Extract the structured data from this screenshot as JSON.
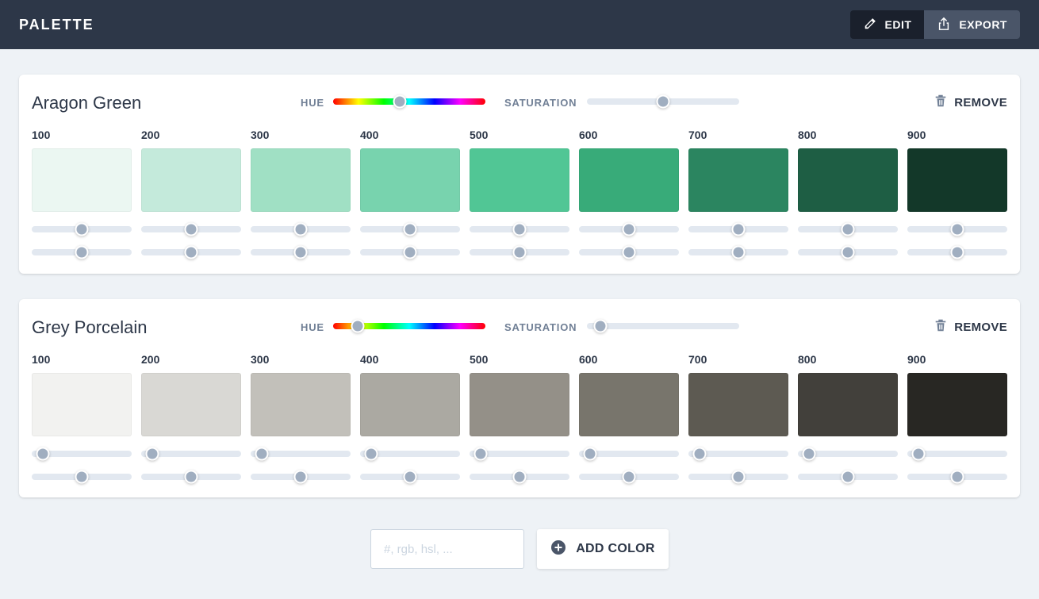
{
  "app": {
    "title": "PALETTE"
  },
  "toolbar": {
    "edit_label": "EDIT",
    "export_label": "EXPORT"
  },
  "labels": {
    "hue": "HUE",
    "saturation": "SATURATION",
    "remove": "REMOVE"
  },
  "colors": [
    {
      "name": "Aragon Green",
      "hue": 0.44,
      "saturation": 0.5,
      "shades": [
        {
          "label": "100",
          "color": "#ebf7f2",
          "s1": 0.5,
          "s2": 0.5
        },
        {
          "label": "200",
          "color": "#c4eadb",
          "s1": 0.5,
          "s2": 0.5
        },
        {
          "label": "300",
          "color": "#a0e0c4",
          "s1": 0.5,
          "s2": 0.5
        },
        {
          "label": "400",
          "color": "#78d3ae",
          "s1": 0.5,
          "s2": 0.5
        },
        {
          "label": "500",
          "color": "#51c695",
          "s1": 0.5,
          "s2": 0.5
        },
        {
          "label": "600",
          "color": "#38ab79",
          "s1": 0.5,
          "s2": 0.5
        },
        {
          "label": "700",
          "color": "#2b8560",
          "s1": 0.5,
          "s2": 0.5
        },
        {
          "label": "800",
          "color": "#1e5e44",
          "s1": 0.5,
          "s2": 0.5
        },
        {
          "label": "900",
          "color": "#133829",
          "s1": 0.5,
          "s2": 0.5
        }
      ]
    },
    {
      "name": "Grey Porcelain",
      "hue": 0.16,
      "saturation": 0.09,
      "shades": [
        {
          "label": "100",
          "color": "#f2f2f0",
          "s1": 0.11,
          "s2": 0.5
        },
        {
          "label": "200",
          "color": "#d9d8d4",
          "s1": 0.11,
          "s2": 0.5
        },
        {
          "label": "300",
          "color": "#c2c0ba",
          "s1": 0.11,
          "s2": 0.5
        },
        {
          "label": "400",
          "color": "#aba9a2",
          "s1": 0.11,
          "s2": 0.5
        },
        {
          "label": "500",
          "color": "#949088",
          "s1": 0.11,
          "s2": 0.5
        },
        {
          "label": "600",
          "color": "#78756c",
          "s1": 0.11,
          "s2": 0.5
        },
        {
          "label": "700",
          "color": "#5d5a52",
          "s1": 0.11,
          "s2": 0.5
        },
        {
          "label": "800",
          "color": "#42403b",
          "s1": 0.11,
          "s2": 0.5
        },
        {
          "label": "900",
          "color": "#282723",
          "s1": 0.11,
          "s2": 0.5
        }
      ]
    }
  ],
  "add": {
    "placeholder": "#, rgb, hsl, ...",
    "value": "",
    "button_label": "ADD COLOR"
  }
}
